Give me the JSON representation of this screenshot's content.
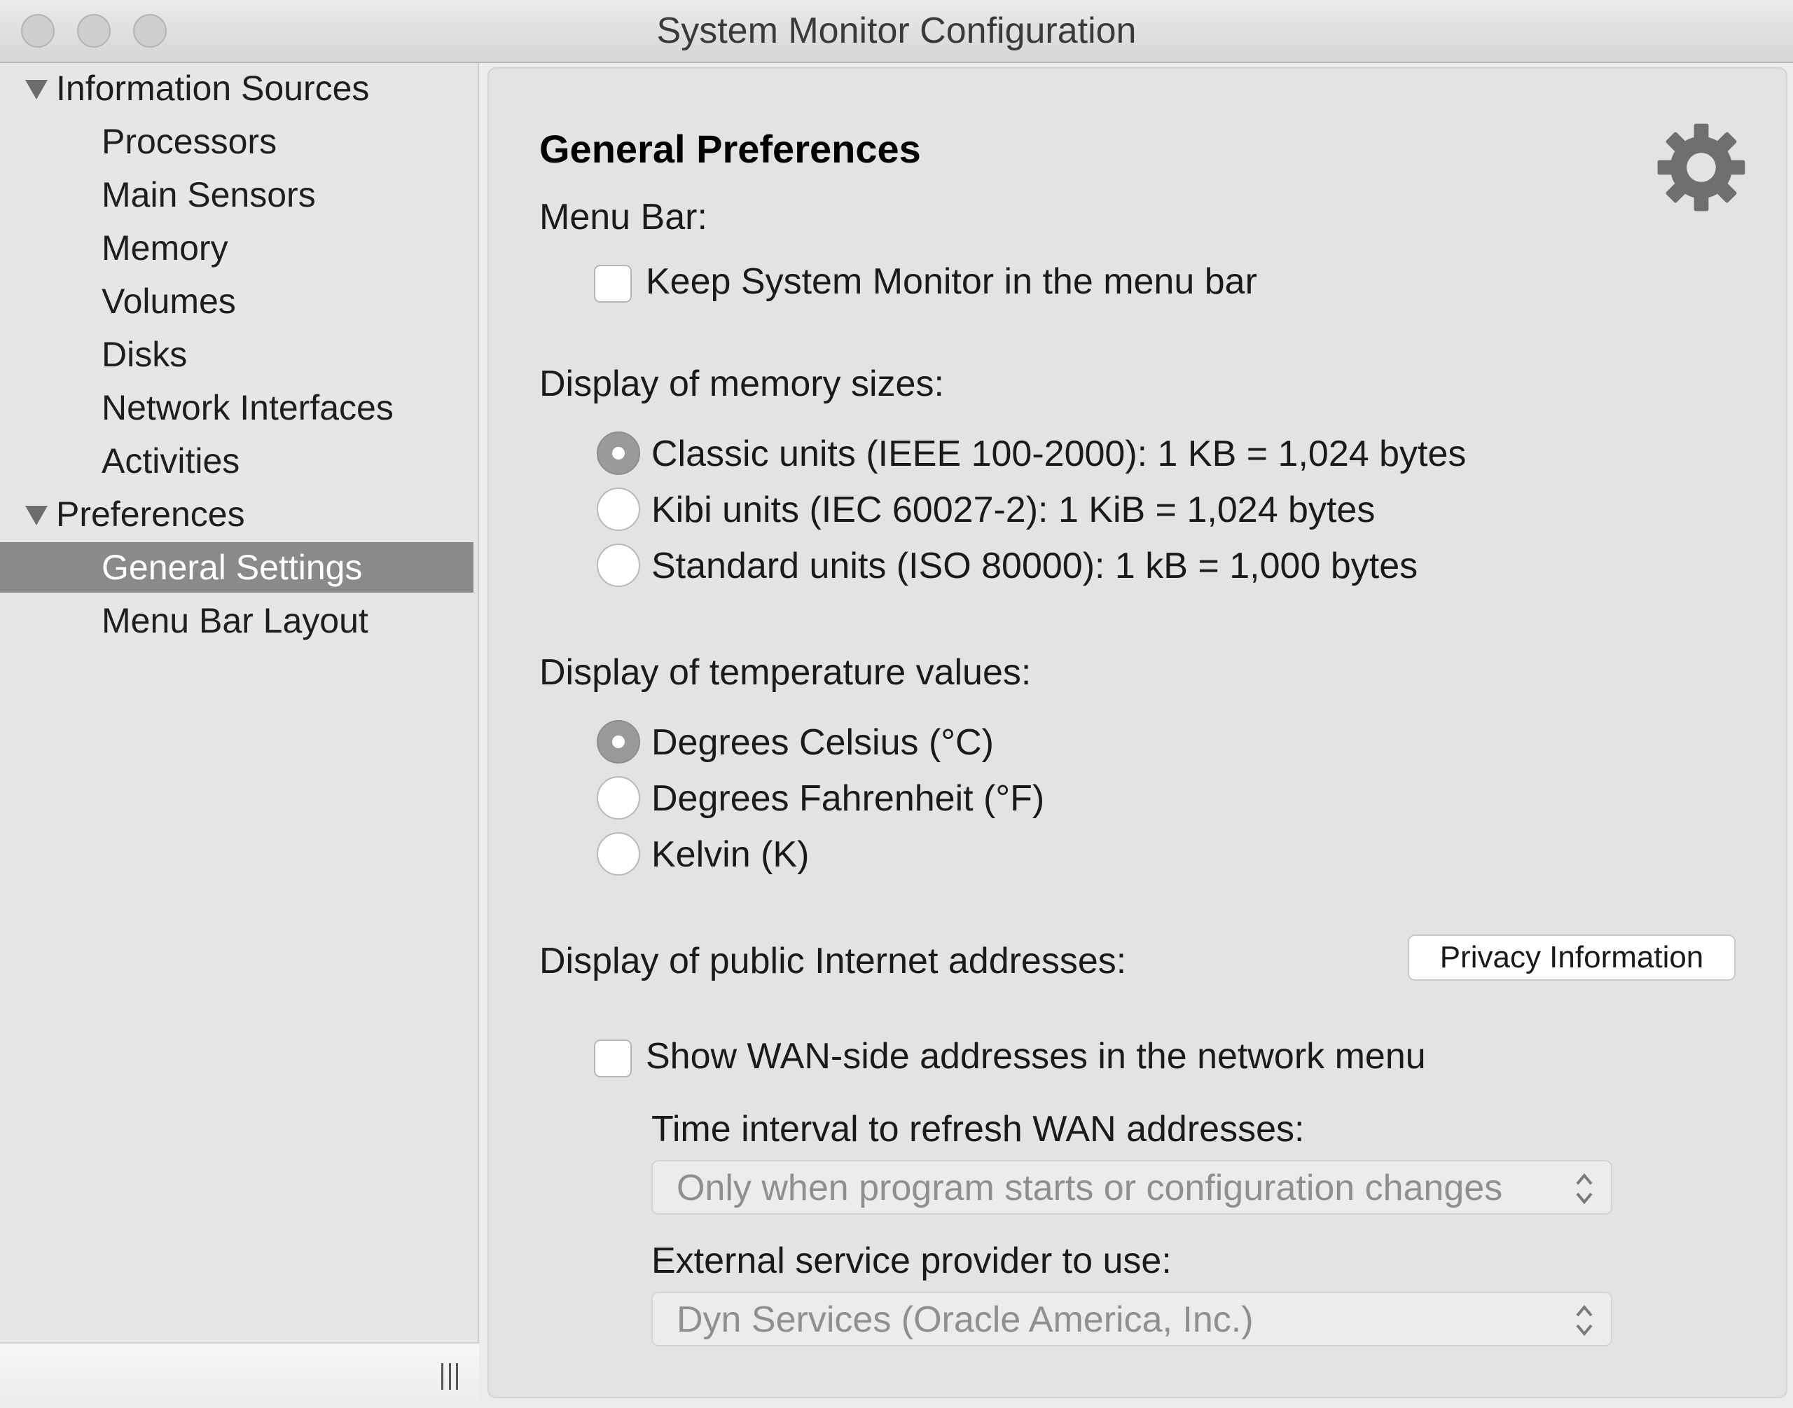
{
  "window": {
    "title": "System Monitor Configuration"
  },
  "sidebar": {
    "groups": [
      {
        "label": "Information Sources",
        "items": [
          "Processors",
          "Main Sensors",
          "Memory",
          "Volumes",
          "Disks",
          "Network Interfaces",
          "Activities"
        ]
      },
      {
        "label": "Preferences",
        "items": [
          "General Settings",
          "Menu Bar Layout"
        ]
      }
    ],
    "selected": "General Settings"
  },
  "general": {
    "heading": "General Preferences",
    "menu_bar": {
      "label": "Menu Bar:",
      "checkbox_label": "Keep System Monitor in the menu bar",
      "checked": false
    },
    "memory_sizes": {
      "label": "Display of memory sizes:",
      "options": [
        "Classic units (IEEE 100-2000): 1 KB = 1,024 bytes",
        "Kibi units (IEC 60027-2): 1 KiB = 1,024 bytes",
        "Standard units (ISO 80000): 1 kB = 1,000 bytes"
      ],
      "selected_index": 0
    },
    "temperature": {
      "label": "Display of temperature values:",
      "options": [
        "Degrees Celsius (°C)",
        "Degrees Fahrenheit (°F)",
        "Kelvin (K)"
      ],
      "selected_index": 0
    },
    "internet": {
      "label": "Display of public Internet addresses:",
      "privacy_button": "Privacy Information",
      "wan_checkbox_label": "Show WAN-side addresses in the network menu",
      "wan_checked": false,
      "interval_label": "Time interval to refresh WAN addresses:",
      "interval_value": "Only when program starts or configuration changes",
      "provider_label": "External service provider to use:",
      "provider_value": "Dyn Services (Oracle America, Inc.)"
    }
  },
  "icons": {
    "settings": "gear-icon",
    "window_controls": [
      "close-button",
      "minimize-button",
      "zoom-button"
    ]
  }
}
